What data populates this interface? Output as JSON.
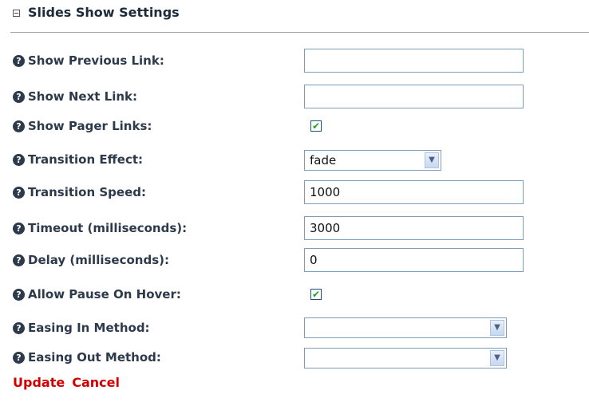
{
  "section": {
    "title": "Slides Show Settings"
  },
  "help_icon_glyph": "?",
  "fields": {
    "show_previous_link": {
      "label": "Show Previous Link:",
      "value": ""
    },
    "show_next_link": {
      "label": "Show Next Link:",
      "value": ""
    },
    "show_pager_links": {
      "label": "Show Pager Links:",
      "checked": true
    },
    "transition_effect": {
      "label": "Transition Effect:",
      "value": "fade"
    },
    "transition_speed": {
      "label": "Transition Speed:",
      "value": "1000"
    },
    "timeout": {
      "label": "Timeout (milliseconds):",
      "value": "3000"
    },
    "delay": {
      "label": "Delay (milliseconds):",
      "value": "0"
    },
    "allow_pause_on_hover": {
      "label": "Allow Pause On Hover:",
      "checked": true
    },
    "easing_in_method": {
      "label": "Easing In Method:",
      "value": ""
    },
    "easing_out_method": {
      "label": "Easing Out Method:",
      "value": ""
    }
  },
  "checkbox_mark": "✔",
  "actions": {
    "update": "Update",
    "cancel": "Cancel"
  },
  "colors": {
    "label": "#2d3a4b",
    "action_link": "#d40000",
    "input_border": "#7f9db9",
    "checkmark": "#21a121"
  }
}
